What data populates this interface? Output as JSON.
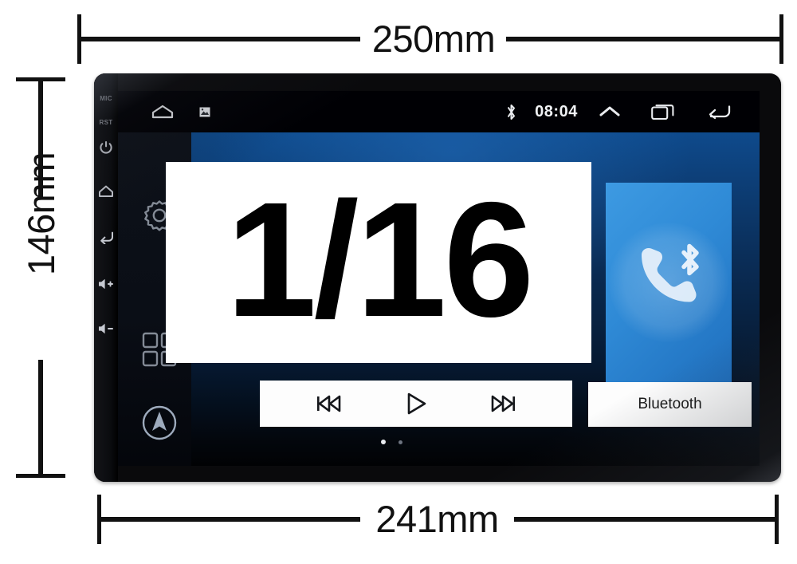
{
  "dimensions": {
    "top": {
      "label": "250mm",
      "name": "width-overall"
    },
    "bottom": {
      "label": "241mm",
      "name": "width-faceplate"
    },
    "left": {
      "label": "146mm",
      "name": "height-overall"
    }
  },
  "overlay": {
    "text": "1/16"
  },
  "device": {
    "hardware_keys": [
      {
        "id": "mic",
        "label": "MIC",
        "type": "text"
      },
      {
        "id": "rst",
        "label": "RST",
        "type": "text"
      },
      {
        "id": "power",
        "label": "power-icon",
        "type": "icon"
      },
      {
        "id": "home",
        "label": "home-icon",
        "type": "icon"
      },
      {
        "id": "back",
        "label": "back-icon",
        "type": "icon"
      },
      {
        "id": "volume-up",
        "label": "volume-up-icon",
        "type": "icon"
      },
      {
        "id": "volume-down",
        "label": "volume-down-icon",
        "type": "icon"
      }
    ],
    "status_bar": {
      "home_icon": "home-icon",
      "notification_icon": "notification-icon",
      "bluetooth_icon": "bluetooth-icon",
      "clock": "08:04",
      "expand_icon": "chevron-up-icon",
      "recents_icon": "recent-apps-icon",
      "back_icon": "back-arrow-icon"
    },
    "screen_shortcuts": [
      {
        "id": "settings",
        "icon": "gear-icon"
      },
      {
        "id": "apps",
        "icon": "apps-grid-icon"
      },
      {
        "id": "navigation",
        "icon": "navigation-compass-icon"
      }
    ],
    "media_controls": [
      {
        "id": "previous",
        "icon": "previous-track-icon"
      },
      {
        "id": "play",
        "icon": "play-icon"
      },
      {
        "id": "next",
        "icon": "next-track-icon"
      }
    ],
    "page_indicator": {
      "total": 2,
      "active": 1
    },
    "tiles": [
      {
        "id": "bluetooth",
        "label": "Bluetooth",
        "icon": "bluetooth-phone-icon",
        "color": "#2f8ad6"
      }
    ]
  },
  "colors": {
    "bezel": "#0a0a0c",
    "wallpaper_blue": "#0d3f78",
    "tile_blue": "#2f8ad6",
    "dimension_line": "#111111",
    "overlay_bg": "#ffffff",
    "overlay_fg": "#000000"
  }
}
